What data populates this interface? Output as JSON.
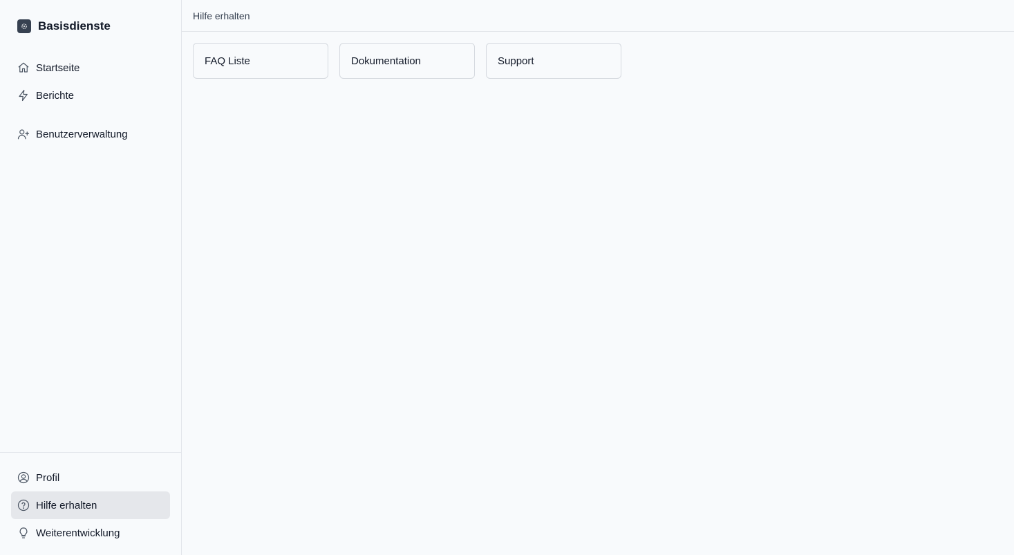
{
  "app": {
    "name": "Basisdienste"
  },
  "sidebar": {
    "top_items": [
      {
        "label": "Startseite",
        "icon": "home-icon"
      },
      {
        "label": "Berichte",
        "icon": "lightning-icon"
      },
      {
        "label": "Benutzerverwaltung",
        "icon": "user-plus-icon"
      }
    ],
    "bottom_items": [
      {
        "label": "Profil",
        "icon": "user-circle-icon"
      },
      {
        "label": "Hilfe erhalten",
        "icon": "question-circle-icon",
        "active": true
      },
      {
        "label": "Weiterentwicklung",
        "icon": "lightbulb-icon"
      }
    ]
  },
  "header": {
    "title": "Hilfe erhalten"
  },
  "main": {
    "cards": [
      {
        "label": "FAQ Liste"
      },
      {
        "label": "Dokumentation"
      },
      {
        "label": "Support"
      }
    ]
  },
  "colors": {
    "background": "#f8fafc",
    "active_item": "#e5e7eb",
    "border": "#e2e5ea",
    "logo": "#374151"
  }
}
